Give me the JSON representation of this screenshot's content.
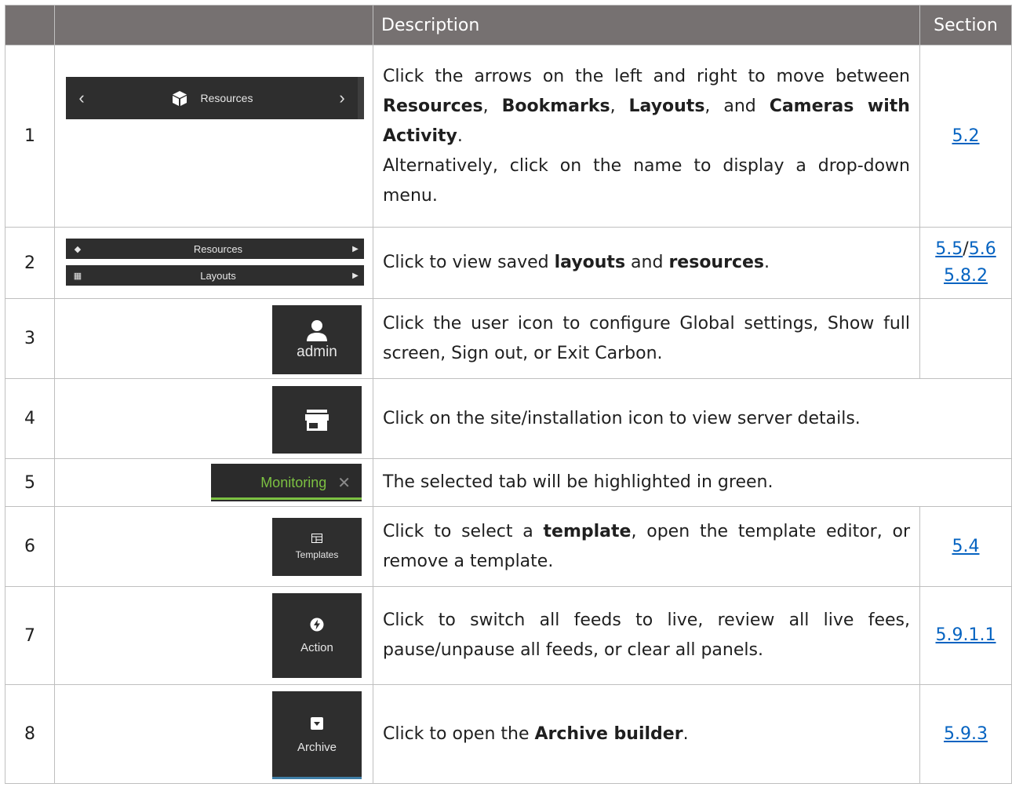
{
  "header": {
    "col1": "",
    "col2": "",
    "description": "Description",
    "section": "Section"
  },
  "rows": [
    {
      "num": "1",
      "widget": {
        "prev_glyph": "‹",
        "label": "Resources",
        "next_glyph": "›"
      },
      "desc": {
        "a": "Click the arrows on the left and right to move between ",
        "b1": "Resources",
        "c": ", ",
        "b2": "Bookmarks",
        "d": ", ",
        "b3": "Layouts",
        "e": ", and ",
        "b4": "Cameras with Activity",
        "f": ".",
        "g": "Alternatively, click on the name to display a drop-down menu."
      },
      "section": "5.2"
    },
    {
      "num": "2",
      "widget": {
        "item1": "Resources",
        "item2": "Layouts"
      },
      "desc": {
        "a": "Click to view saved ",
        "b1": "layouts",
        "c": " and ",
        "b2": "resources",
        "d": "."
      },
      "section": {
        "a": "5.5",
        "sep": "/",
        "b": "5.6",
        "c": "5.8.2"
      }
    },
    {
      "num": "3",
      "widget": {
        "label": "admin"
      },
      "desc": "Click the user icon to configure Global settings, Show full screen, Sign out, or Exit Carbon.",
      "section": ""
    },
    {
      "num": "4",
      "desc": "Click on the site/installation icon to view server details."
    },
    {
      "num": "5",
      "widget": {
        "label": "Monitoring",
        "close": "✕"
      },
      "desc": "The selected tab will be highlighted in green."
    },
    {
      "num": "6",
      "widget": {
        "label": "Templates"
      },
      "desc": {
        "a": "Click to select a ",
        "b1": "template",
        "c": ", open the template editor, or remove a template."
      },
      "section": "5.4"
    },
    {
      "num": "7",
      "widget": {
        "label": "Action"
      },
      "desc": "Click to switch all feeds to live, review all live fees, pause/unpause all feeds, or clear all panels.",
      "section": "5.9.1.1"
    },
    {
      "num": "8",
      "widget": {
        "label": "Archive"
      },
      "desc": {
        "a": "Click to open the ",
        "b1": "Archive builder",
        "c": "."
      },
      "section": "5.9.3"
    }
  ],
  "colors": {
    "header_bg": "#767171",
    "link": "#0563c1",
    "tab_green": "#7cc142",
    "widget_bg": "#2e2e2e"
  }
}
